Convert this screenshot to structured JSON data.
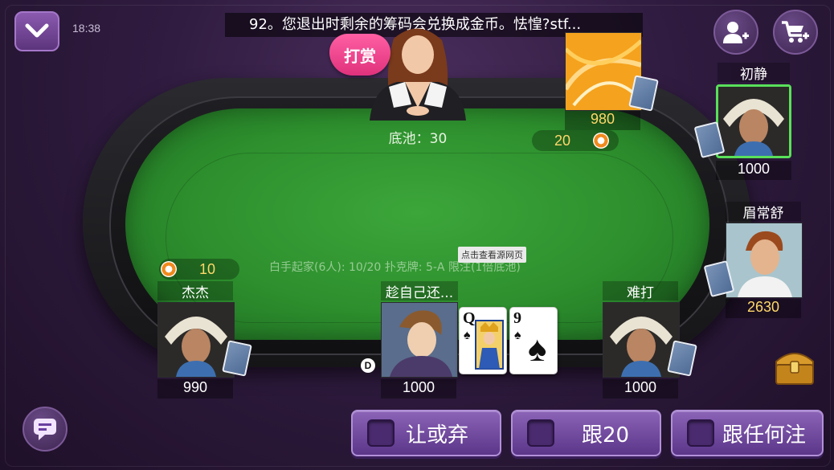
{
  "header": {
    "time": "18:38",
    "marquee": "92。您退出时剩余的筹码会兑换成金币。怯惶?stf..."
  },
  "dealer": {
    "tip_label": "打赏",
    "pot_text": "底池：30"
  },
  "table_info": {
    "rules": "白手起家(6人): 10/20  扑克牌: 5-A  限注(1倍底池)",
    "tooltip": "点击查看源网页",
    "dealer_marker": "D"
  },
  "seats": {
    "top": {
      "name": "",
      "chips": "980",
      "bet": "20"
    },
    "top_right": {
      "name": "初静",
      "chips": "1000"
    },
    "right": {
      "name": "眉常舒",
      "chips": "2630"
    },
    "left": {
      "name": "杰杰",
      "chips": "990",
      "bet": "10"
    },
    "self": {
      "name": "趁自己还...",
      "chips": "1000"
    },
    "bottom_right": {
      "name": "难打",
      "chips": "1000"
    }
  },
  "hole_cards": [
    {
      "rank": "Q",
      "suit": "♠"
    },
    {
      "rank": "9",
      "suit": "♠"
    }
  ],
  "actions": {
    "check_fold": "让或弃",
    "call": "跟20",
    "call_any": "跟任何注"
  },
  "icons": {
    "collapse": "chevron-down-icon",
    "add_friend": "add-user-icon",
    "shop": "cart-icon",
    "chat": "chat-icon",
    "chest": "treasure-chest-icon"
  },
  "colors": {
    "felt": "#2d8f2d",
    "button_purple": "#6d45a0",
    "chip_text": "#ffd86a",
    "active_highlight": "#59e05a"
  }
}
